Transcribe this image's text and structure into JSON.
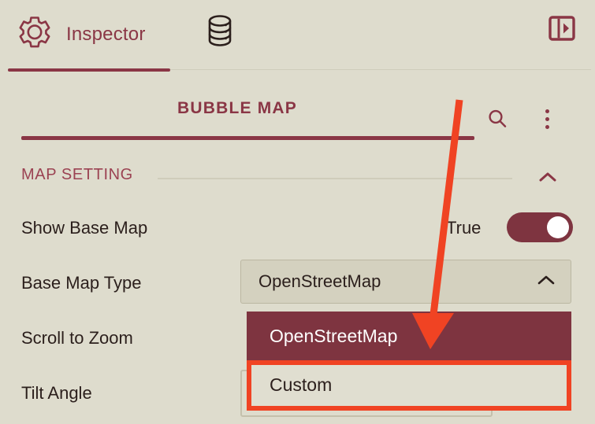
{
  "toolbar": {
    "tab_label": "Inspector",
    "gear_icon": "gear-icon",
    "database_icon": "database-icon",
    "panel_toggle_icon": "panel-toggle-icon",
    "accent_color": "#8A3645"
  },
  "panel": {
    "title": "BUBBLE MAP",
    "search_icon": "search-icon",
    "more_icon": "kebab-menu-icon",
    "title_color": "#8A3645"
  },
  "section": {
    "title": "MAP SETTING",
    "collapse_icon": "chevron-up-icon"
  },
  "properties": [
    {
      "label": "Show Base Map",
      "value": "True",
      "control": "toggle",
      "toggle_on": true,
      "toggle_color": "#7E3440"
    },
    {
      "label": "Base Map Type",
      "value": "OpenStreetMap",
      "control": "dropdown",
      "expanded": true,
      "chevron_icon": "chevron-up-icon"
    },
    {
      "label": "Scroll to Zoom",
      "value": "",
      "control": "none"
    },
    {
      "label": "Tilt Angle",
      "value": "",
      "control": "input"
    }
  ],
  "dropdown": {
    "options": [
      {
        "label": "OpenStreetMap",
        "selected": true
      },
      {
        "label": "Custom",
        "selected": false
      }
    ],
    "selected_bg": "#7E3440",
    "option_bg": "#E0DED0"
  },
  "annotation": {
    "arrow_color": "#F04323",
    "highlight_color": "#F04323",
    "arrow_target": "Custom"
  },
  "theme": {
    "background": "#DEDCCD",
    "text": "#2B1F1C",
    "accent": "#8A3645"
  }
}
